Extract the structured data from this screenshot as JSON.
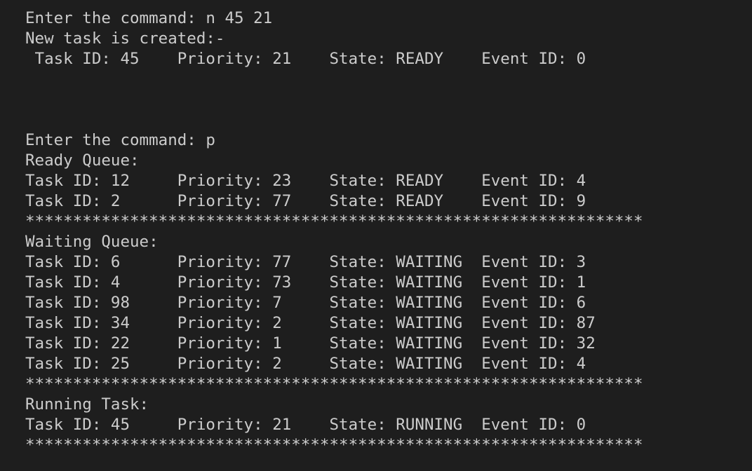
{
  "terminal": {
    "lines": [
      "Enter the command: n 45 21",
      "New task is created:-",
      " Task ID: 45    Priority: 21    State: READY    Event ID: 0",
      "",
      "",
      "",
      "Enter the command: p",
      "Ready Queue:",
      "Task ID: 12     Priority: 23    State: READY    Event ID: 4",
      "Task ID: 2      Priority: 77    State: READY    Event ID: 9",
      "*****************************************************************",
      "Waiting Queue:",
      "Task ID: 6      Priority: 77    State: WAITING  Event ID: 3",
      "Task ID: 4      Priority: 73    State: WAITING  Event ID: 1",
      "Task ID: 98     Priority: 7     State: WAITING  Event ID: 6",
      "Task ID: 34     Priority: 2     State: WAITING  Event ID: 87",
      "Task ID: 22     Priority: 1     State: WAITING  Event ID: 32",
      "Task ID: 25     Priority: 2     State: WAITING  Event ID: 4",
      "*****************************************************************",
      "Running Task:",
      "Task ID: 45     Priority: 21    State: RUNNING  Event ID: 0",
      "*****************************************************************"
    ]
  }
}
